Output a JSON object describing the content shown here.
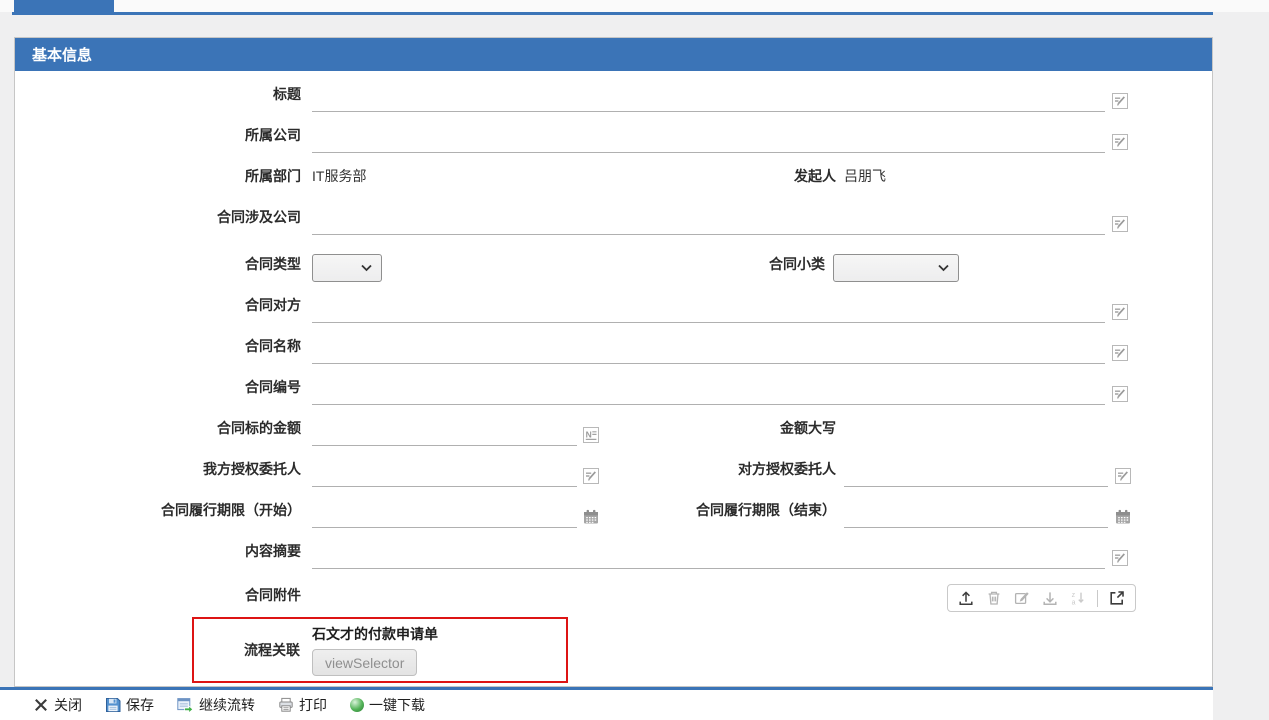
{
  "panel": {
    "title": "基本信息"
  },
  "fields": {
    "title": "标题",
    "company": "所属公司",
    "department": "所属部门",
    "department_value": "IT服务部",
    "initiator": "发起人",
    "initiator_value": "吕朋飞",
    "involved_company": "合同涉及公司",
    "contract_type": "合同类型",
    "contract_subtype": "合同小类",
    "counterparty": "合同对方",
    "contract_name": "合同名称",
    "contract_number": "合同编号",
    "amount": "合同标的金额",
    "amount_in_words": "金额大写",
    "our_agent": "我方授权委托人",
    "counterparty_agent": "对方授权委托人",
    "period_start": "合同履行期限（开始）",
    "period_end": "合同履行期限（结束）",
    "summary": "内容摘要",
    "attachments": "合同附件",
    "workflow_relation": "流程关联",
    "workflow_link": "石文才的付款申请单",
    "workflow_button": "viewSelector"
  },
  "attachments_toolbar": {
    "icons": [
      "upload",
      "delete",
      "edit",
      "download",
      "sort",
      "open-in-new-window"
    ]
  },
  "footer": {
    "close": "关闭",
    "save": "保存",
    "continue_flow": "继续流转",
    "print": "打印",
    "one_click_download": "一键下载"
  },
  "colors": {
    "accent": "#3b74b7",
    "annotation_box": "#dd1414"
  }
}
